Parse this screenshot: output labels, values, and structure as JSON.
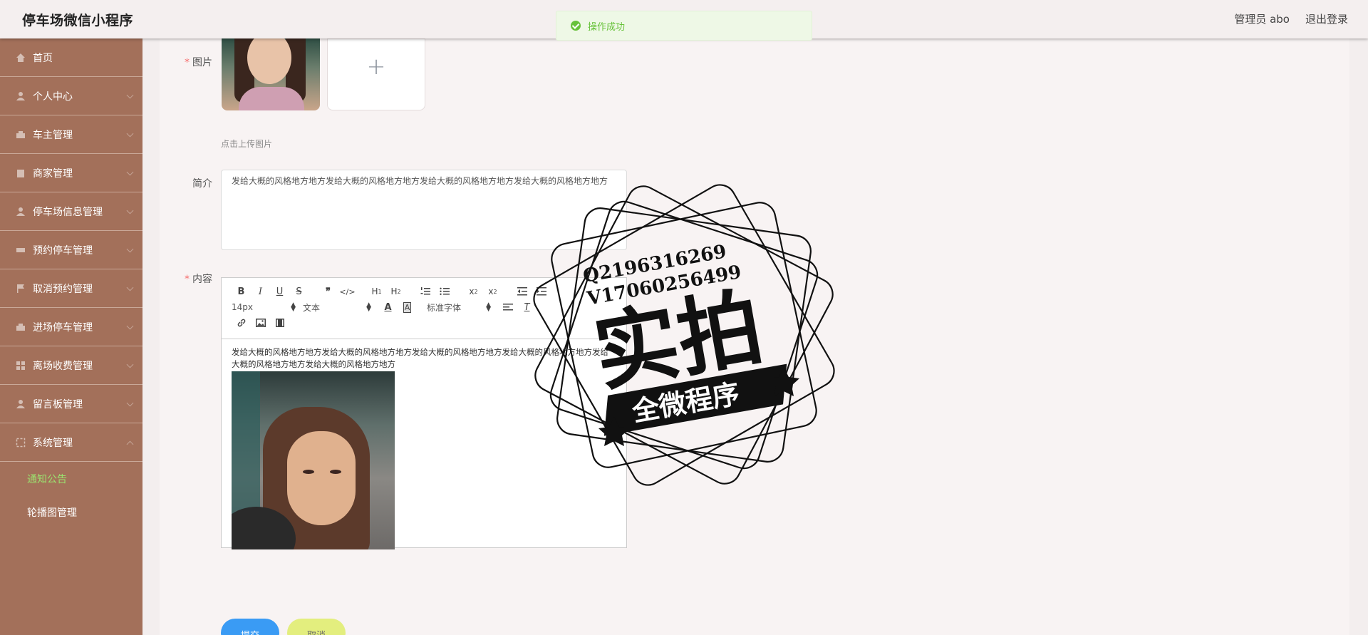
{
  "header": {
    "app_title": "停车场微信小程序",
    "user_label": "管理员 abo",
    "logout_label": "退出登录"
  },
  "toast": {
    "message": "操作成功",
    "accent": "#67c23a"
  },
  "sidebar": {
    "bg_color": "#a3705a",
    "items": [
      {
        "label": "首页",
        "icon": "home-icon"
      },
      {
        "label": "个人中心",
        "icon": "user-icon"
      },
      {
        "label": "车主管理",
        "icon": "car-owner-icon"
      },
      {
        "label": "商家管理",
        "icon": "store-icon"
      },
      {
        "label": "停车场信息管理",
        "icon": "parking-info-icon"
      },
      {
        "label": "预约停车管理",
        "icon": "reservation-icon"
      },
      {
        "label": "取消预约管理",
        "icon": "flag-icon"
      },
      {
        "label": "进场停车管理",
        "icon": "entry-icon"
      },
      {
        "label": "离场收费管理",
        "icon": "grid-icon"
      },
      {
        "label": "留言板管理",
        "icon": "message-icon"
      },
      {
        "label": "系统管理",
        "icon": "system-icon"
      }
    ],
    "sub_items": [
      {
        "label": "通知公告",
        "active": true
      },
      {
        "label": "轮播图管理",
        "active": false
      }
    ]
  },
  "form": {
    "image_label": "图片",
    "upload_hint": "点击上传图片",
    "intro_label": "简介",
    "intro_value": "发给大概的风格地方地方发给大概的风格地方地方发给大概的风格地方地方发给大概的风格地方地方",
    "content_label": "内容",
    "editor": {
      "font_size": "14px",
      "paragraph_style": "文本",
      "font_family": "标准字体",
      "body_text": "发给大概的风格地方地方发给大概的风格地方地方发给大概的风格地方地方发给大概的风格地方地方发给大概的风格地方地方发给大概的风格地方地方"
    },
    "submit_label": "提交",
    "cancel_label": "取消"
  },
  "watermark": {
    "qq": "Q2196316269",
    "wechat": "V17060256499",
    "main_text": "实拍",
    "banner_text": "全微程序"
  }
}
